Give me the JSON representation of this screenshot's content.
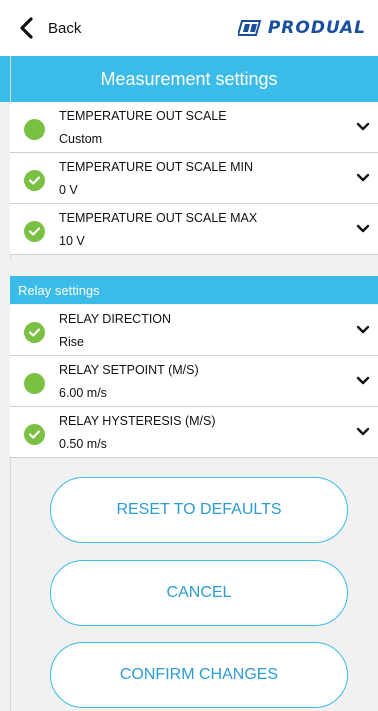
{
  "header": {
    "back_label": "Back",
    "logo_text": "PRODUAL"
  },
  "title": "Measurement settings",
  "measurement_rows": [
    {
      "label": "TEMPERATURE OUT SCALE",
      "value": "Custom",
      "status": "set"
    },
    {
      "label": "TEMPERATURE OUT SCALE MIN",
      "value": "0 V",
      "status": "confirmed"
    },
    {
      "label": "TEMPERATURE OUT SCALE MAX",
      "value": "10 V",
      "status": "confirmed"
    }
  ],
  "relay_section_title": "Relay settings",
  "relay_rows": [
    {
      "label": "RELAY DIRECTION",
      "value": "Rise",
      "status": "confirmed"
    },
    {
      "label": "RELAY SETPOINT (M/S)",
      "value": "6.00 m/s",
      "status": "set"
    },
    {
      "label": "RELAY HYSTERESIS (M/S)",
      "value": "0.50 m/s",
      "status": "confirmed"
    }
  ],
  "buttons": {
    "reset": "RESET TO DEFAULTS",
    "cancel": "CANCEL",
    "confirm": "CONFIRM CHANGES"
  },
  "colors": {
    "accent": "#3bbbe8",
    "status_green": "#7ac143",
    "logo_blue": "#1a4fa0"
  }
}
